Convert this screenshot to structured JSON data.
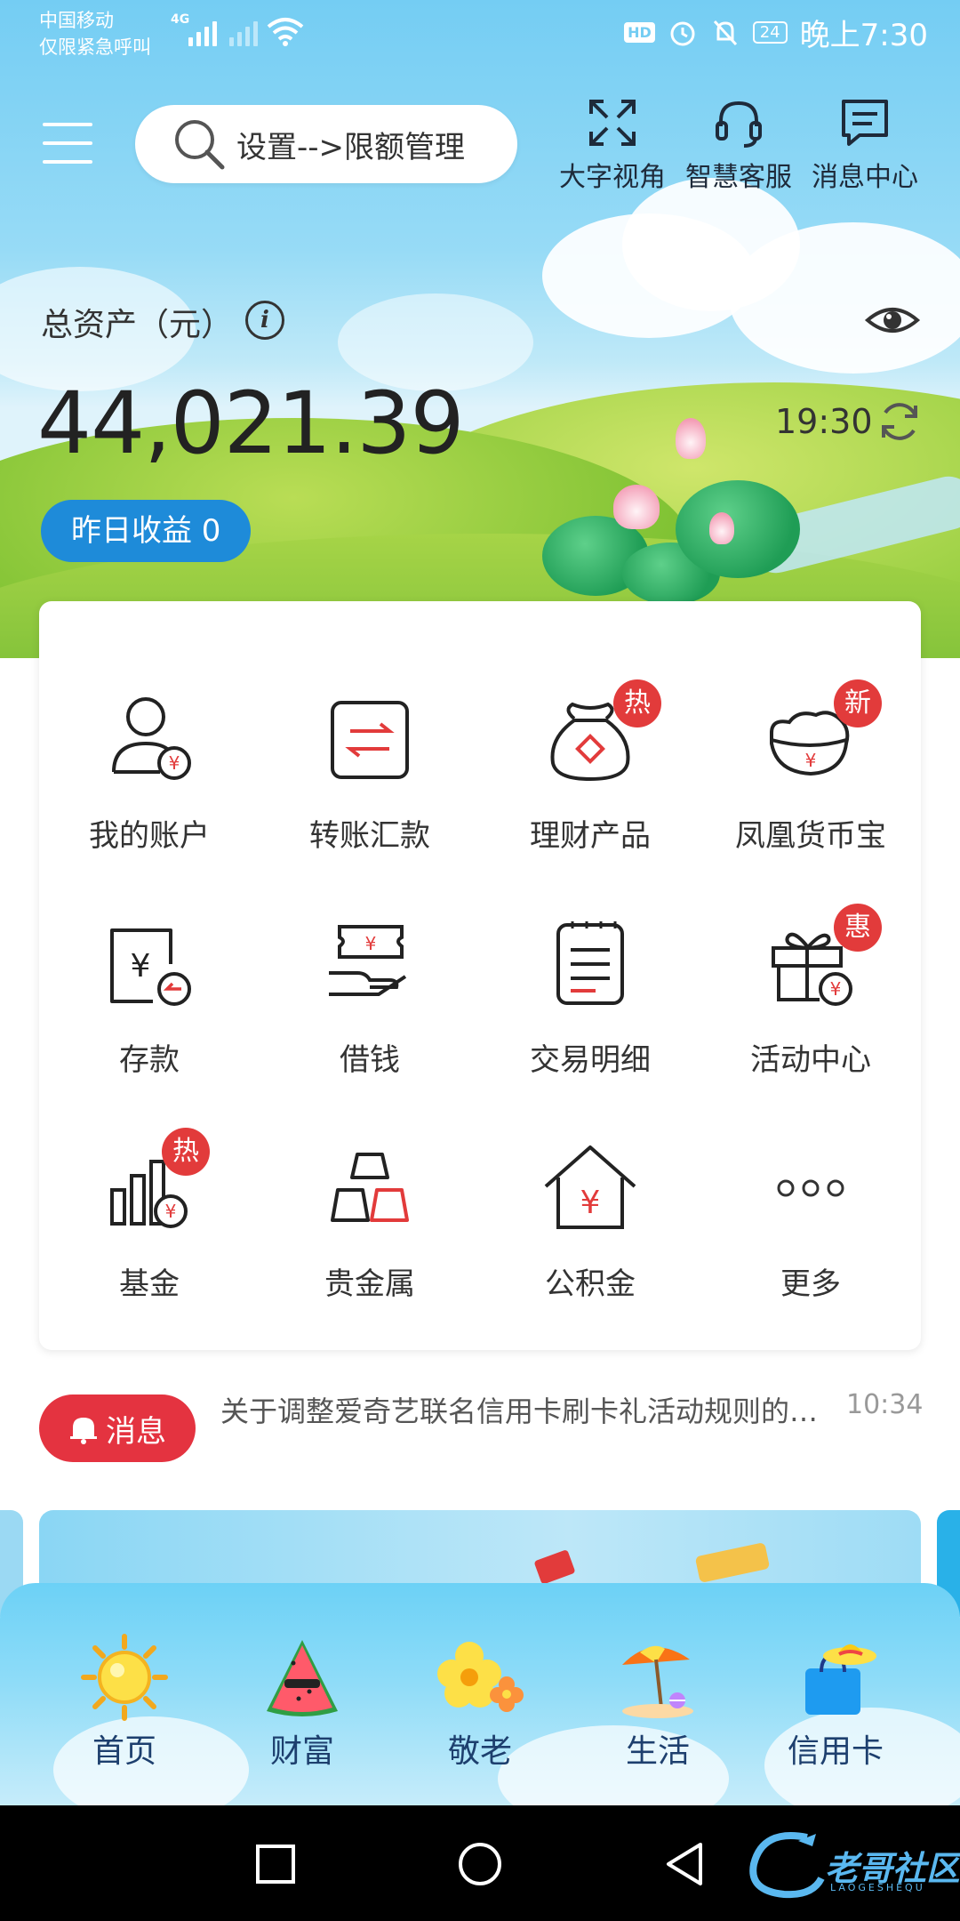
{
  "status_bar": {
    "carrier_line1": "中国移动",
    "carrier_line2": "仅限紧急呼叫",
    "network": "4G",
    "battery": "24",
    "time": "晚上7:30"
  },
  "header": {
    "search_placeholder": "设置-->限额管理",
    "actions": [
      {
        "label": "大字视角",
        "icon": "expand-icon"
      },
      {
        "label": "智慧客服",
        "icon": "headset-icon"
      },
      {
        "label": "消息中心",
        "icon": "message-icon"
      }
    ]
  },
  "assets": {
    "label": "总资产（元）",
    "amount": "44,021.39",
    "update_time": "19:30",
    "yesterday_yield": "昨日收益  0"
  },
  "grid": [
    {
      "label": "我的账户",
      "icon": "account-icon",
      "badge": ""
    },
    {
      "label": "转账汇款",
      "icon": "transfer-icon",
      "badge": ""
    },
    {
      "label": "理财产品",
      "icon": "wealth-bag-icon",
      "badge": "热"
    },
    {
      "label": "凤凰货币宝",
      "icon": "money-pot-icon",
      "badge": "新"
    },
    {
      "label": "存款",
      "icon": "deposit-icon",
      "badge": ""
    },
    {
      "label": "借钱",
      "icon": "loan-icon",
      "badge": ""
    },
    {
      "label": "交易明细",
      "icon": "statement-icon",
      "badge": ""
    },
    {
      "label": "活动中心",
      "icon": "gift-icon",
      "badge": "惠"
    },
    {
      "label": "基金",
      "icon": "fund-chart-icon",
      "badge": "热"
    },
    {
      "label": "贵金属",
      "icon": "gold-bars-icon",
      "badge": ""
    },
    {
      "label": "公积金",
      "icon": "house-fund-icon",
      "badge": ""
    },
    {
      "label": "更多",
      "icon": "more-dots-icon",
      "badge": ""
    }
  ],
  "message": {
    "label": "消息",
    "text": "关于调整爱奇艺联名信用卡刷卡礼活动规则的公告",
    "time": "10:34"
  },
  "tabs": [
    {
      "label": "首页",
      "icon": "sun-icon"
    },
    {
      "label": "财富",
      "icon": "watermelon-icon"
    },
    {
      "label": "敬老",
      "icon": "flower-icon"
    },
    {
      "label": "生活",
      "icon": "beach-umbrella-icon"
    },
    {
      "label": "信用卡",
      "icon": "shopping-bag-icon"
    }
  ],
  "watermark": {
    "text": "老哥社区",
    "sub": "LAOGESHEQU"
  },
  "colors": {
    "brand_red": "#e23b3b",
    "accent_blue": "#1e8bd9",
    "sky": "#74cdf3"
  }
}
